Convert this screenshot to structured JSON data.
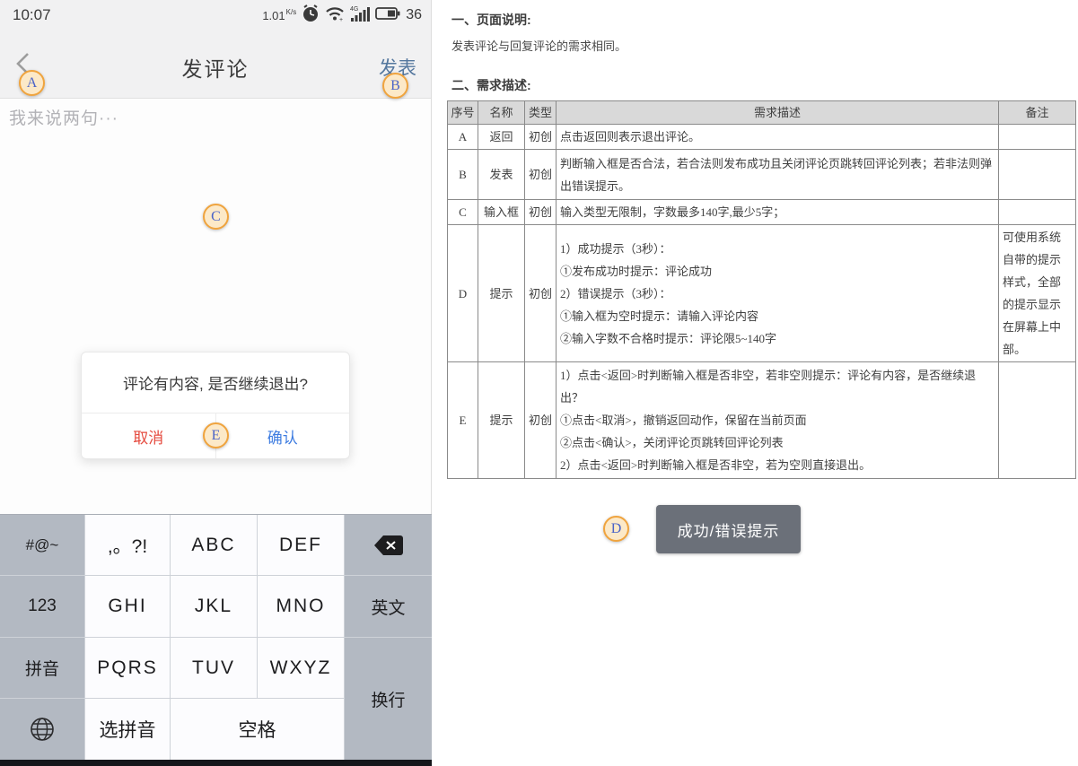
{
  "phone": {
    "status_bar": {
      "time": "10:07",
      "net_speed": "1.01",
      "net_speed_unit_top": "K",
      "net_speed_unit_bottom": "s",
      "signal_label": "4G",
      "battery_percent": "36"
    },
    "nav": {
      "title": "发评论",
      "publish_label": "发表"
    },
    "composer": {
      "placeholder": "我来说两句···"
    },
    "dialog": {
      "message": "评论有内容, 是否继续退出?",
      "cancel_label": "取消",
      "confirm_label": "确认"
    },
    "keyboard": {
      "keys": {
        "sym": "#@~",
        "punct": ",。?!",
        "abc": "ABC",
        "def": "DEF",
        "num": "123",
        "ghi": "GHI",
        "jkl": "JKL",
        "mno": "MNO",
        "english": "英文",
        "pinyin": "拼音",
        "pqrs": "PQRS",
        "tuv": "TUV",
        "wxyz": "WXYZ",
        "newline": "换行",
        "select_pinyin": "选拼音",
        "space": "空格"
      }
    },
    "annotations": {
      "a": "A",
      "b": "B",
      "c": "C",
      "e": "E"
    }
  },
  "doc": {
    "section1_title": "一、页面说明:",
    "section1_body": "发表评论与回复评论的需求相同。",
    "section2_title": "二、需求描述:",
    "table": {
      "headers": {
        "seq": "序号",
        "name": "名称",
        "type": "类型",
        "desc": "需求描述",
        "remark": "备注"
      },
      "rows": [
        {
          "seq": "A",
          "name": "返回",
          "type": "初创",
          "desc": "点击返回则表示退出评论。",
          "remark": ""
        },
        {
          "seq": "B",
          "name": "发表",
          "type": "初创",
          "desc": "判断输入框是否合法，若合法则发布成功且关闭评论页跳转回评论列表；若非法则弹出错误提示。",
          "remark": ""
        },
        {
          "seq": "C",
          "name": "输入框",
          "type": "初创",
          "desc": "输入类型无限制，字数最多140字,最少5字；",
          "remark": ""
        },
        {
          "seq": "D",
          "name": "提示",
          "type": "初创",
          "desc": "1）成功提示（3秒）：\n①发布成功时提示：评论成功\n2）错误提示（3秒）：\n①输入框为空时提示：请输入评论内容\n②输入字数不合格时提示：评论限5~140字",
          "remark": "可使用系统自带的提示样式，全部的提示显示在屏幕上中部。"
        },
        {
          "seq": "E",
          "name": "提示",
          "type": "初创",
          "desc": "1）点击<返回>时判断输入框是否非空，若非空则提示：评论有内容，是否继续退出？\n①点击<取消>，撤销返回动作，保留在当前页面\n②点击<确认>，关闭评论页跳转回评论列表\n2）点击<返回>时判断输入框是否非空，若为空则直接退出。",
          "remark": ""
        }
      ]
    },
    "demo": {
      "label": "D",
      "button_label": "成功/错误提示"
    }
  },
  "colors": {
    "accent_orange": "#f0a43e",
    "annotation_blue": "#4a63c8",
    "publish_blue": "#54779e",
    "cancel_red": "#e5493d",
    "confirm_blue": "#3e7ce0",
    "demo_button_gray": "#6b7079",
    "header_gray": "#d9d9d9"
  }
}
